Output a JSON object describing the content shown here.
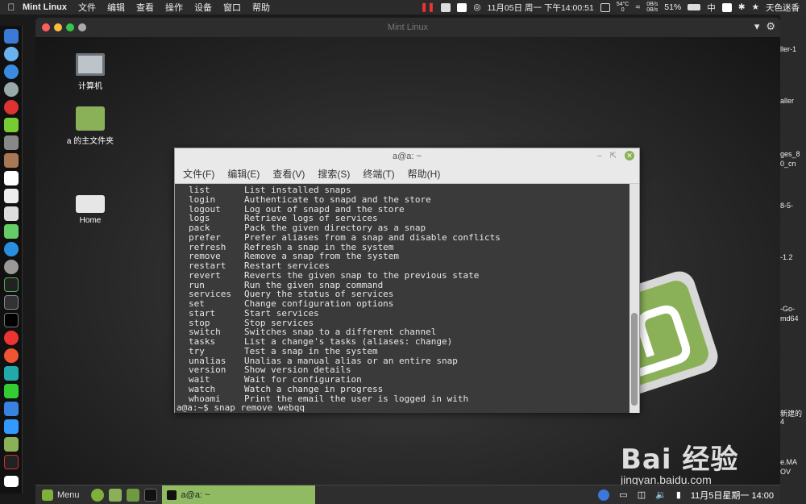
{
  "mac_menubar": {
    "app_name": "Mint Linux",
    "menus": [
      "文件",
      "编辑",
      "查看",
      "操作",
      "设备",
      "窗口",
      "帮助"
    ],
    "cpu_temp": "54°C",
    "cpu_zero": "0",
    "net_up": "0B/s",
    "net_down": "0B/s",
    "datetime": "11月05日 周一 下午14:00:51",
    "battery": "51%",
    "input_method": "中",
    "user": "天色迷香"
  },
  "vm_window": {
    "title": "Mint Linux"
  },
  "right_strip": {
    "labels": [
      "ller-1",
      "aller",
      "ges_8",
      "0_cn",
      "8-5-",
      "-1.2",
      "-Go-",
      "md64",
      "新建的",
      "4",
      "e.MA",
      "OV"
    ]
  },
  "desktop": {
    "icons": [
      {
        "label": "计算机"
      },
      {
        "label": "a 的主文件夹"
      },
      {
        "label": "Home"
      }
    ]
  },
  "terminal": {
    "title": "a@a: ~",
    "menu": [
      "文件(F)",
      "编辑(E)",
      "查看(V)",
      "搜索(S)",
      "终端(T)",
      "帮助(H)"
    ],
    "rows": [
      {
        "cmd": "list",
        "desc": "List installed snaps"
      },
      {
        "cmd": "login",
        "desc": "Authenticate to snapd and the store"
      },
      {
        "cmd": "logout",
        "desc": "Log out of snapd and the store"
      },
      {
        "cmd": "logs",
        "desc": "Retrieve logs of services"
      },
      {
        "cmd": "pack",
        "desc": "Pack the given directory as a snap"
      },
      {
        "cmd": "prefer",
        "desc": "Prefer aliases from a snap and disable conflicts"
      },
      {
        "cmd": "refresh",
        "desc": "Refresh a snap in the system"
      },
      {
        "cmd": "remove",
        "desc": "Remove a snap from the system"
      },
      {
        "cmd": "restart",
        "desc": "Restart services"
      },
      {
        "cmd": "revert",
        "desc": "Reverts the given snap to the previous state"
      },
      {
        "cmd": "run",
        "desc": "Run the given snap command"
      },
      {
        "cmd": "services",
        "desc": "Query the status of services"
      },
      {
        "cmd": "set",
        "desc": "Change configuration options"
      },
      {
        "cmd": "start",
        "desc": "Start services"
      },
      {
        "cmd": "stop",
        "desc": "Stop services"
      },
      {
        "cmd": "switch",
        "desc": "Switches snap to a different channel"
      },
      {
        "cmd": "tasks",
        "desc": "List a change's tasks (aliases: change)"
      },
      {
        "cmd": "try",
        "desc": "Test a snap in the system"
      },
      {
        "cmd": "unalias",
        "desc": "Unalias a manual alias or an entire snap"
      },
      {
        "cmd": "version",
        "desc": "Show version details"
      },
      {
        "cmd": "wait",
        "desc": "Wait for configuration"
      },
      {
        "cmd": "watch",
        "desc": "Watch a change in progress"
      },
      {
        "cmd": "whoami",
        "desc": "Print the email the user is logged in with"
      }
    ],
    "prompt": "a@a:~$ ",
    "typed_command": "snap remove webqq"
  },
  "mint_panel": {
    "menu_label": "Menu",
    "task_label": "a@a: ~",
    "clock": "11月5日星期一  14:00"
  },
  "watermark": {
    "brand": "Bai 经验",
    "url": "jingyan.baidu.com"
  },
  "colors": {
    "mint_green": "#8bb158",
    "highlight_underline": "#e02020"
  }
}
